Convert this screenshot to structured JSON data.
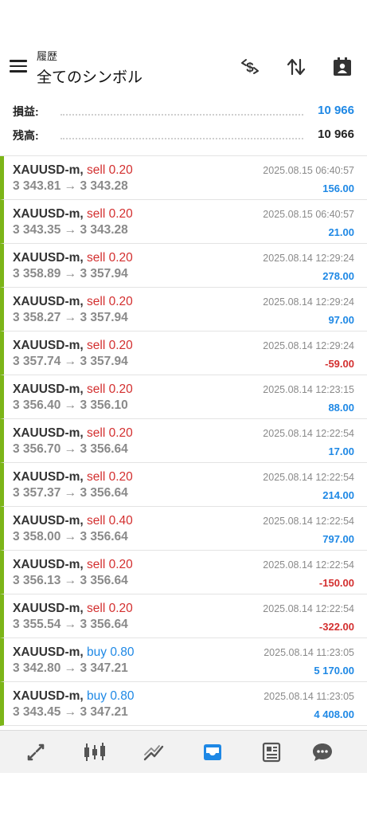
{
  "header": {
    "subtitle": "履歴",
    "title": "全てのシンボル",
    "menu_icon": "hamburger-menu-icon",
    "actions": [
      "currency-exchange-icon",
      "sort-icon",
      "calendar-user-icon"
    ]
  },
  "summary": {
    "profit_label": "損益:",
    "profit_value": "10 966",
    "balance_label": "残高:",
    "balance_value": "10 966"
  },
  "colors": {
    "accent_blue": "#1e88e5",
    "sell_red": "#d32f2f",
    "row_bar_green": "#7cb518"
  },
  "trades": [
    {
      "symbol": "XAUUSD-m,",
      "side": "sell 0.20",
      "side_type": "sell",
      "prices": "3 343.81 → 3 343.28",
      "time": "2025.08.15 06:40:57",
      "profit": "156.00",
      "sign": "pos"
    },
    {
      "symbol": "XAUUSD-m,",
      "side": "sell 0.20",
      "side_type": "sell",
      "prices": "3 343.35 → 3 343.28",
      "time": "2025.08.15 06:40:57",
      "profit": "21.00",
      "sign": "pos"
    },
    {
      "symbol": "XAUUSD-m,",
      "side": "sell 0.20",
      "side_type": "sell",
      "prices": "3 358.89 → 3 357.94",
      "time": "2025.08.14 12:29:24",
      "profit": "278.00",
      "sign": "pos"
    },
    {
      "symbol": "XAUUSD-m,",
      "side": "sell 0.20",
      "side_type": "sell",
      "prices": "3 358.27 → 3 357.94",
      "time": "2025.08.14 12:29:24",
      "profit": "97.00",
      "sign": "pos"
    },
    {
      "symbol": "XAUUSD-m,",
      "side": "sell 0.20",
      "side_type": "sell",
      "prices": "3 357.74 → 3 357.94",
      "time": "2025.08.14 12:29:24",
      "profit": "-59.00",
      "sign": "neg"
    },
    {
      "symbol": "XAUUSD-m,",
      "side": "sell 0.20",
      "side_type": "sell",
      "prices": "3 356.40 → 3 356.10",
      "time": "2025.08.14 12:23:15",
      "profit": "88.00",
      "sign": "pos"
    },
    {
      "symbol": "XAUUSD-m,",
      "side": "sell 0.20",
      "side_type": "sell",
      "prices": "3 356.70 → 3 356.64",
      "time": "2025.08.14 12:22:54",
      "profit": "17.00",
      "sign": "pos"
    },
    {
      "symbol": "XAUUSD-m,",
      "side": "sell 0.20",
      "side_type": "sell",
      "prices": "3 357.37 → 3 356.64",
      "time": "2025.08.14 12:22:54",
      "profit": "214.00",
      "sign": "pos"
    },
    {
      "symbol": "XAUUSD-m,",
      "side": "sell 0.40",
      "side_type": "sell",
      "prices": "3 358.00 → 3 356.64",
      "time": "2025.08.14 12:22:54",
      "profit": "797.00",
      "sign": "pos"
    },
    {
      "symbol": "XAUUSD-m,",
      "side": "sell 0.20",
      "side_type": "sell",
      "prices": "3 356.13 → 3 356.64",
      "time": "2025.08.14 12:22:54",
      "profit": "-150.00",
      "sign": "neg"
    },
    {
      "symbol": "XAUUSD-m,",
      "side": "sell 0.20",
      "side_type": "sell",
      "prices": "3 355.54 → 3 356.64",
      "time": "2025.08.14 12:22:54",
      "profit": "-322.00",
      "sign": "neg"
    },
    {
      "symbol": "XAUUSD-m,",
      "side": "buy 0.80",
      "side_type": "buy",
      "prices": "3 342.80 → 3 347.21",
      "time": "2025.08.14 11:23:05",
      "profit": "5 170.00",
      "sign": "pos"
    },
    {
      "symbol": "XAUUSD-m,",
      "side": "buy 0.80",
      "side_type": "buy",
      "prices": "3 343.45 → 3 347.21",
      "time": "2025.08.14 11:23:05",
      "profit": "4 408.00",
      "sign": "pos"
    }
  ],
  "bottom_nav": {
    "items": [
      "quotes-icon",
      "chart-icon",
      "trade-icon",
      "history-icon",
      "news-icon",
      "chat-icon"
    ],
    "active": "history-icon"
  }
}
